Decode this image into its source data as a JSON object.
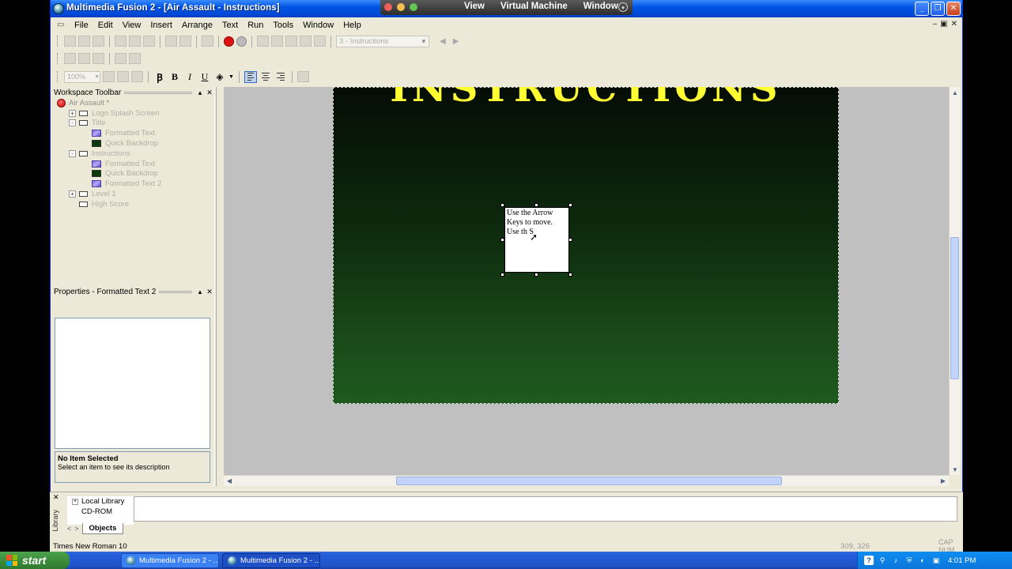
{
  "window": {
    "title": "Multimedia Fusion 2 - [Air Assault - Instructions]",
    "min": "_",
    "restore": "❐",
    "close": "✕"
  },
  "vmbar": {
    "menu": [
      "View",
      "Virtual Machine",
      "Window"
    ]
  },
  "menubar": {
    "items": [
      "File",
      "Edit",
      "View",
      "Insert",
      "Arrange",
      "Text",
      "Run",
      "Tools",
      "Window",
      "Help"
    ]
  },
  "toolbar": {
    "frame_select": "3 - Instructions",
    "zoom": "100%",
    "bold": "B",
    "italic": "I",
    "underline": "U"
  },
  "workspace": {
    "title": "Workspace Toolbar",
    "tree": [
      {
        "label": "Air Assault *",
        "level": 0,
        "icon": "app"
      },
      {
        "label": "Logo Splash Screen",
        "level": 1,
        "icon": "frame",
        "exp": "+"
      },
      {
        "label": "Title",
        "level": 1,
        "icon": "frame",
        "exp": "-"
      },
      {
        "label": "Formatted Text",
        "level": 2,
        "icon": "ft"
      },
      {
        "label": "Quick Backdrop",
        "level": 2,
        "icon": "bd"
      },
      {
        "label": "Instructions",
        "level": 1,
        "icon": "frame",
        "exp": "-"
      },
      {
        "label": "Formatted Text",
        "level": 2,
        "icon": "ft"
      },
      {
        "label": "Quick Backdrop",
        "level": 2,
        "icon": "bd"
      },
      {
        "label": "Formatted Text 2",
        "level": 2,
        "icon": "ft"
      },
      {
        "label": "Level 1",
        "level": 1,
        "icon": "frame",
        "exp": "+"
      },
      {
        "label": "High Score",
        "level": 1,
        "icon": "frame"
      }
    ]
  },
  "properties": {
    "title": "Properties - Formatted Text 2",
    "desc_title": "No Item Selected",
    "desc_text": "Select an item to see its description"
  },
  "editor": {
    "headline": "INSTRUCTIONS",
    "textbox": "Use the Arrow Keys to move. Use th S"
  },
  "library": {
    "label": "Library",
    "items": [
      "Local Library",
      "CD-ROM"
    ],
    "tab": "Objects"
  },
  "status": {
    "font": "Times New Roman 10",
    "coords": "309, 326",
    "caps": "CAP  NUM"
  },
  "taskbar": {
    "start": "start",
    "tasks": [
      "Multimedia Fusion 2 - ...",
      "Multimedia Fusion 2 - ..."
    ],
    "clock": "4:01 PM"
  }
}
